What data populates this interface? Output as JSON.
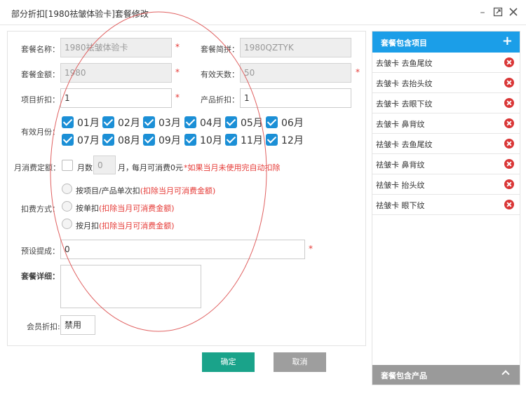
{
  "window": {
    "title": "部分折扣[1980祛皱体验卡]套餐修改"
  },
  "form": {
    "package_name": {
      "label": "套餐名称：",
      "value": "1980祛皱体验卡"
    },
    "package_short": {
      "label": "套餐简拼：",
      "value": "1980QZTYK"
    },
    "package_amount": {
      "label": "套餐金额：",
      "value": "1980"
    },
    "valid_days": {
      "label": "有效天数：",
      "value": "50"
    },
    "item_discount": {
      "label": "项目折扣：",
      "value": "1"
    },
    "product_discount": {
      "label": "产品折扣：",
      "value": "1"
    },
    "required_mark": "*",
    "valid_months": {
      "label": "有效月份：",
      "months": [
        "01月",
        "02月",
        "03月",
        "04月",
        "05月",
        "06月",
        "07月",
        "08月",
        "09月",
        "10月",
        "11月",
        "12月"
      ]
    },
    "monthly_fixed": {
      "label": "月消费定额：",
      "months_label": "月数",
      "months_value": "0",
      "month_unit": "月，",
      "monthly_text": "每月可消费0元",
      "note": "*如果当月未使用完自动扣除"
    },
    "deduct": {
      "label": "扣费方式：",
      "options": [
        {
          "main": "按项目/产品单次扣",
          "note": "(扣除当月可消费金额)"
        },
        {
          "main": "按单扣",
          "note": "(扣除当月可消费金额)"
        },
        {
          "main": "按月扣",
          "note": "(扣除当月可消费金额)"
        }
      ]
    },
    "commission": {
      "label": "预设提成：",
      "value": "0"
    },
    "details": {
      "label": "套餐详细：",
      "value": ""
    },
    "member_discount": {
      "label": "会员折扣:",
      "value": "禁用"
    }
  },
  "buttons": {
    "confirm": "确定",
    "cancel": "取消"
  },
  "panel": {
    "title": "套餐包含项目",
    "add_symbol": "+",
    "items": [
      "去皱卡 去鱼尾纹",
      "去皱卡 去抬头纹",
      "去皱卡 去眼下纹",
      "去皱卡 鼻背纹",
      "祛皱卡 去鱼尾纹",
      "祛皱卡 鼻背纹",
      "祛皱卡 抬头纹",
      "祛皱卡 眼下纹"
    ],
    "footer": "套餐包含产品"
  },
  "colors": {
    "accent": "#1b9ee8",
    "confirm": "#1aa38a",
    "cancel": "#9e9e9e",
    "required": "#e53935",
    "delete": "#d93636",
    "annotation": "#e06060"
  }
}
